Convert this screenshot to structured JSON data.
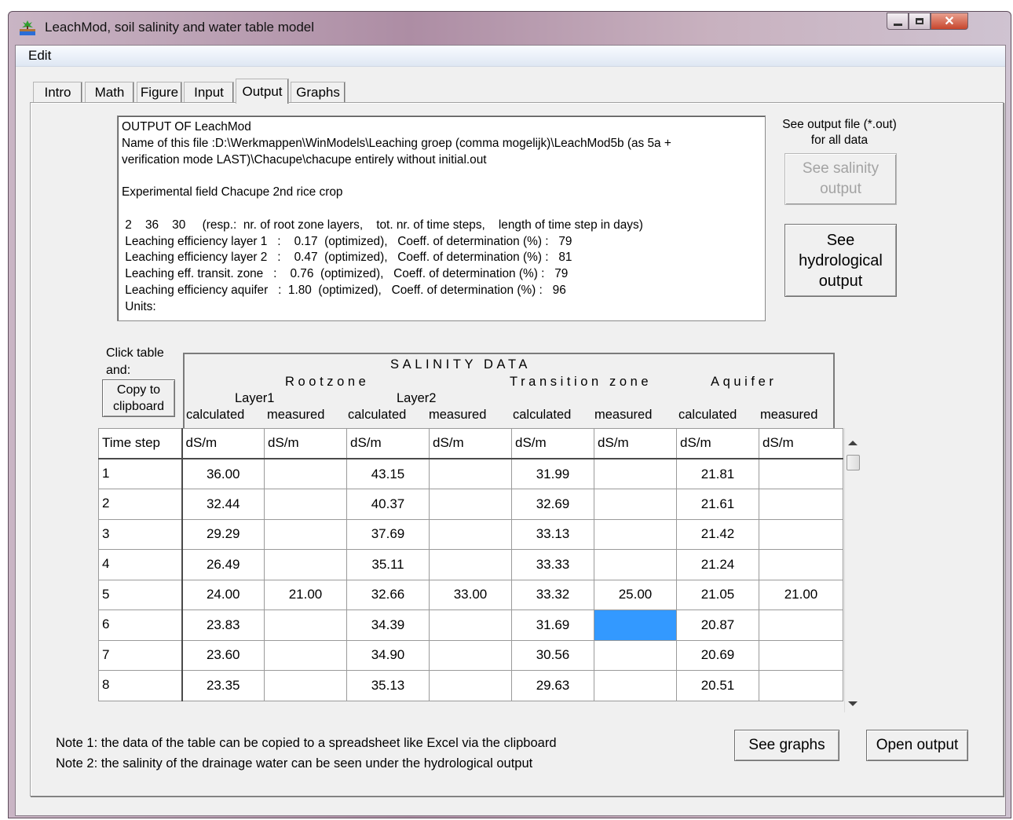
{
  "window": {
    "title": "LeachMod, soil salinity and water table model",
    "icon": "app-landscape-icon"
  },
  "menu": [
    "Edit"
  ],
  "tabs": [
    {
      "label": "Intro",
      "active": false
    },
    {
      "label": "Math",
      "active": false
    },
    {
      "label": "Figure",
      "active": false
    },
    {
      "label": "Input",
      "active": false
    },
    {
      "label": "Output",
      "active": true
    },
    {
      "label": "Graphs",
      "active": false
    }
  ],
  "output_text": [
    "OUTPUT OF LeachMod",
    "Name of this file :D:\\Werkmappen\\WinModels\\Leaching groep (comma mogelijk)\\LeachMod5b (as 5a +",
    "verification mode LAST)\\Chacupe\\chacupe entirely without initial.out",
    "",
    "Experimental field Chacupe 2nd rice crop",
    "",
    " 2    36    30     (resp.:  nr. of root zone layers,    tot. nr. of time steps,    length of time step in days)",
    " Leaching efficiency layer 1   :    0.17  (optimized),   Coeff. of determination (%) :   79",
    " Leaching efficiency layer 2   :    0.47  (optimized),   Coeff. of determination (%) :   81",
    " Leaching eff. transit. zone   :    0.76  (optimized),   Coeff. of determination (%) :   79",
    " Leaching efficiency aquifer   :  1.80  (optimized),   Coeff. of determination (%) :   96",
    " Units:"
  ],
  "side": {
    "see_file_note": "See output file (*.out) for all data",
    "salinity_button": "See salinity output",
    "hydrological_button": "See hydrological output"
  },
  "table_controls": {
    "click_note_1": "Click table",
    "click_note_2": "and:",
    "copy_button_1": "Copy to",
    "copy_button_2": "clipboard"
  },
  "header": {
    "title": "SALINITY  DATA",
    "rootzone": "Rootzone",
    "layer1": "Layer1",
    "layer2": "Layer2",
    "transition": "Transition zone",
    "aquifer": "Aquifer",
    "calc": "calculated",
    "meas": "measured"
  },
  "grid": {
    "step_header": "Time step",
    "unit": "dS/m",
    "rows": [
      [
        "1",
        "36.00",
        "",
        "43.15",
        "",
        "31.99",
        "",
        "21.81",
        ""
      ],
      [
        "2",
        "32.44",
        "",
        "40.37",
        "",
        "32.69",
        "",
        "21.61",
        ""
      ],
      [
        "3",
        "29.29",
        "",
        "37.69",
        "",
        "33.13",
        "",
        "21.42",
        ""
      ],
      [
        "4",
        "26.49",
        "",
        "35.11",
        "",
        "33.33",
        "",
        "21.24",
        ""
      ],
      [
        "5",
        "24.00",
        "21.00",
        "32.66",
        "33.00",
        "33.32",
        "25.00",
        "21.05",
        "21.00"
      ],
      [
        "6",
        "23.83",
        "",
        "34.39",
        "",
        "31.69",
        "",
        "20.87",
        ""
      ],
      [
        "7",
        "23.60",
        "",
        "34.90",
        "",
        "30.56",
        "",
        "20.69",
        ""
      ],
      [
        "8",
        "23.35",
        "",
        "35.13",
        "",
        "29.63",
        "",
        "20.51",
        ""
      ]
    ],
    "selected_row": 6,
    "selected_col": 6,
    "selection_color": "#3399ff"
  },
  "notes": [
    "Note 1: the data of the table can be copied to a spreadsheet like Excel via the clipboard",
    "Note 2: the salinity of the drainage water can be seen under the hydrological output"
  ],
  "buttons": {
    "see_graphs": "See graphs",
    "open_output": "Open output"
  }
}
